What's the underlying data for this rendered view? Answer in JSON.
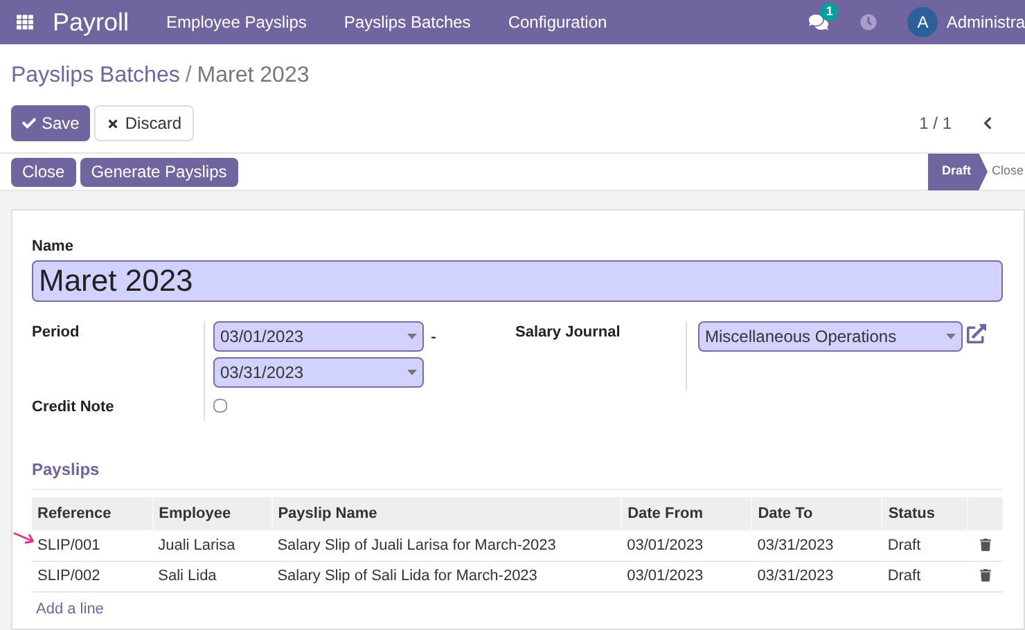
{
  "navbar": {
    "app": "Payroll",
    "menu": [
      "Employee Payslips",
      "Payslips Batches",
      "Configuration"
    ],
    "messages_badge": "1",
    "avatar": "A",
    "user": "Administra"
  },
  "breadcrumb": {
    "parent": "Payslips Batches",
    "separator": "/",
    "current": "Maret 2023"
  },
  "actions": {
    "save": "Save",
    "discard": "Discard",
    "pager": "1 / 1"
  },
  "header_buttons": [
    "Close",
    "Generate Payslips"
  ],
  "stages": [
    {
      "label": "Draft",
      "selected": true
    },
    {
      "label": "Close",
      "selected": false
    }
  ],
  "form": {
    "name_label": "Name",
    "name": "Maret 2023",
    "period_label": "Period",
    "date_from": "03/01/2023",
    "separator": "-",
    "date_to": "03/31/2023",
    "credit_note_label": "Credit Note",
    "credit_note": false,
    "journal_label": "Salary Journal",
    "journal": "Miscellaneous Operations"
  },
  "payslips": {
    "title": "Payslips",
    "columns": [
      "Reference",
      "Employee",
      "Payslip Name",
      "Date From",
      "Date To",
      "Status"
    ],
    "rows": [
      {
        "cells": [
          "SLIP/001",
          "Juali Larisa",
          "Salary Slip of Juali Larisa for March-2023",
          "03/01/2023",
          "03/31/2023",
          "Draft"
        ],
        "marked": true
      },
      {
        "cells": [
          "SLIP/002",
          "Sali Lida",
          "Salary Slip of Sali Lida for March-2023",
          "03/01/2023",
          "03/31/2023",
          "Draft"
        ],
        "marked": false
      }
    ],
    "add_line": "Add a line"
  }
}
